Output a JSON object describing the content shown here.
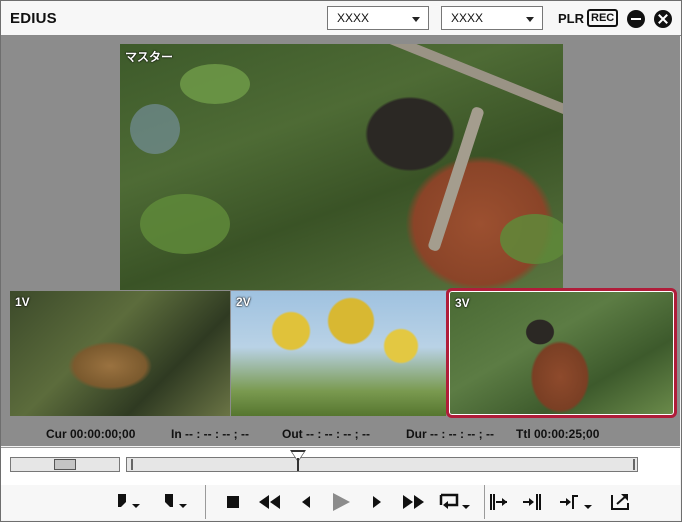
{
  "window": {
    "title": "EDIUS",
    "dropdowns": [
      {
        "value": "XXXX"
      },
      {
        "value": "XXXX"
      }
    ],
    "plr_label": "PLR",
    "rec_label": "REC"
  },
  "monitor": {
    "master_label": "マスター",
    "cameras": [
      {
        "label": "1V"
      },
      {
        "label": "2V"
      },
      {
        "label": "3V",
        "selected": true
      }
    ],
    "selected_border_color": "#b01d3a"
  },
  "timecode": {
    "cur": "Cur 00:00:00;00",
    "in": "In -- : -- : -- ; --",
    "out": "Out -- : -- : -- ; --",
    "dur": "Dur -- : -- : -- ; --",
    "ttl": "Ttl 00:00:25;00"
  },
  "controls": {
    "icons": [
      "set-in-icon",
      "set-out-icon",
      "stop-icon",
      "rewind-icon",
      "step-back-icon",
      "play-icon",
      "step-forward-icon",
      "fast-forward-icon",
      "loop-icon",
      "insert-to-timeline-icon",
      "overwrite-to-timeline-icon",
      "jump-to-out-icon",
      "export-icon"
    ]
  }
}
